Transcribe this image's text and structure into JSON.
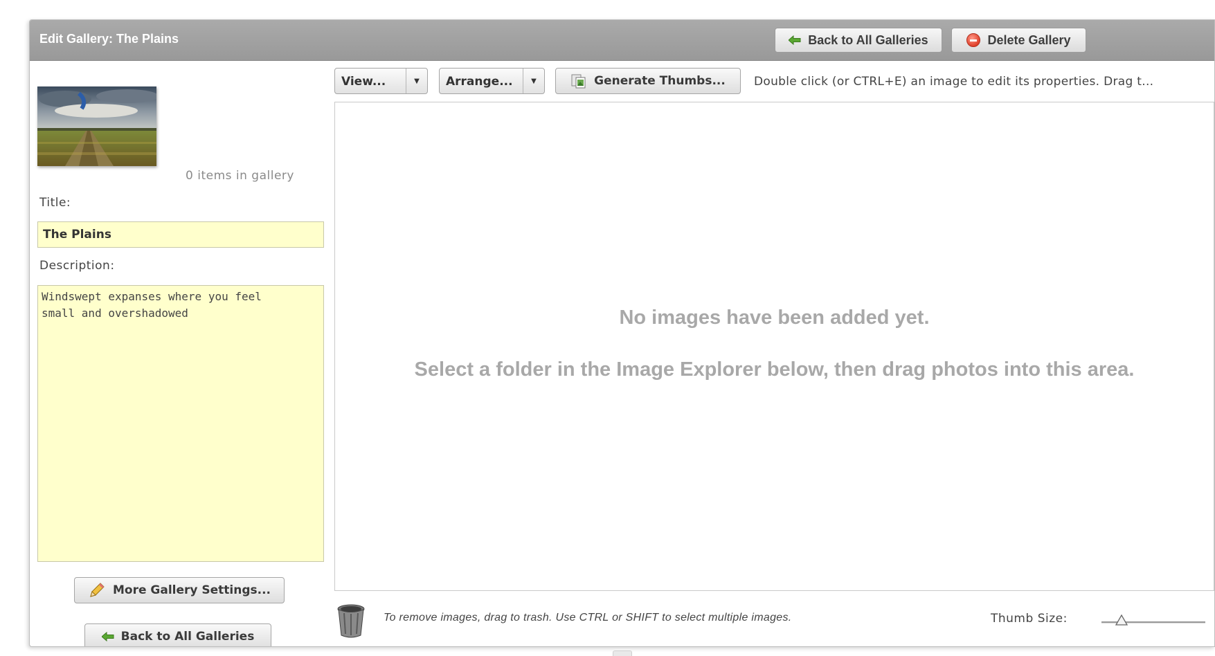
{
  "header": {
    "title": "Edit Gallery: The Plains",
    "back_label": "Back to All Galleries",
    "delete_label": "Delete Gallery"
  },
  "sidebar": {
    "items_count": "0 items in gallery",
    "title_label": "Title:",
    "title_value": "The Plains",
    "description_label": "Description:",
    "description_value": "Windswept expanses where you feel\nsmall and overshadowed",
    "more_settings_label": "More Gallery Settings...",
    "back_label": "Back to All Galleries"
  },
  "toolbar": {
    "view_label": "View...",
    "arrange_label": "Arrange...",
    "generate_label": "Generate Thumbs...",
    "hint": "Double click (or CTRL+E) an image to edit its properties.   Drag t..."
  },
  "droparea": {
    "empty_title": "No images have been added yet.",
    "empty_subtitle": "Select a folder in the Image Explorer below, then drag photos into this area."
  },
  "footer": {
    "remove_hint": "To remove images, drag to trash.  Use CTRL or SHIFT to select multiple images.",
    "thumb_size_label": "Thumb Size:",
    "thumb_size_level": 0.2
  },
  "icons": {
    "back": "left-arrow-icon",
    "delete": "minus-circle-icon",
    "generate": "thumbnails-icon",
    "more_settings": "pencil-icon",
    "trash": "trash-icon"
  },
  "colors": {
    "titlebar": "#9e9e9e",
    "field_background": "#ffffcc",
    "arrow_green": "#4e9a2e",
    "delete_red": "#e0402a"
  }
}
